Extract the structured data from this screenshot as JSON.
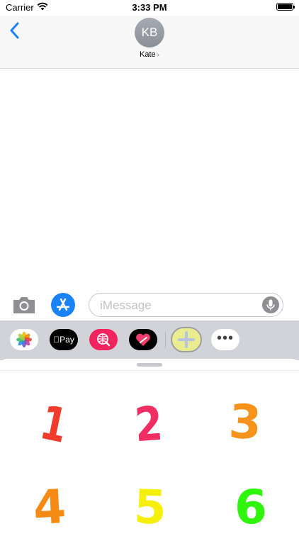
{
  "status_bar": {
    "carrier": "Carrier",
    "time": "3:33 PM"
  },
  "header": {
    "avatar_initials": "KB",
    "contact_name": "Kate",
    "chevron": "›"
  },
  "compose": {
    "placeholder": "iMessage"
  },
  "app_drawer": {
    "apps": [
      {
        "name": "photos-app-icon"
      },
      {
        "name": "apple-pay-app-icon",
        "label": "Pay"
      },
      {
        "name": "search-globe-app-icon"
      },
      {
        "name": "heart-app-icon"
      },
      {
        "name": "plus-app-icon"
      },
      {
        "name": "more-apps-icon",
        "label": "•••"
      }
    ]
  },
  "stickers": [
    {
      "value": "1",
      "color": "#f03c2d"
    },
    {
      "value": "2",
      "color": "#ef2e63"
    },
    {
      "value": "3",
      "color": "#f5931d"
    },
    {
      "value": "4",
      "color": "#f58a14"
    },
    {
      "value": "5",
      "color": "#f6ef0c"
    },
    {
      "value": "6",
      "color": "#2ff40c"
    }
  ],
  "colors": {
    "accent": "#1a82f7",
    "nav_background": "#f7f7f7",
    "app_strip": "#d1d3d8"
  }
}
